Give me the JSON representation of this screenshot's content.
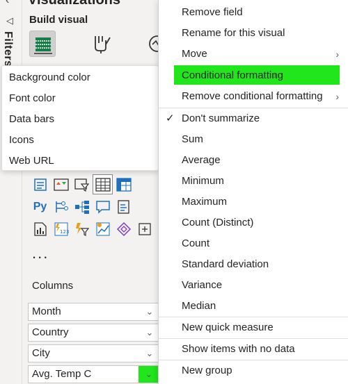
{
  "filters": {
    "label": "Filters"
  },
  "viz": {
    "header": "Visualizations",
    "build_visual": "Build visual",
    "columns_label": "Columns",
    "more": "...",
    "fields": [
      {
        "label": "Month"
      },
      {
        "label": "Country"
      },
      {
        "label": "City"
      },
      {
        "label": "Avg. Temp C"
      }
    ]
  },
  "submenu": {
    "items": [
      "Background color",
      "Font color",
      "Data bars",
      "Icons",
      "Web URL"
    ]
  },
  "menu": {
    "items": {
      "remove_field": "Remove field",
      "rename": "Rename for this visual",
      "move": "Move",
      "conditional_formatting": "Conditional formatting",
      "remove_conditional": "Remove conditional formatting",
      "dont_summarize": "Don't summarize",
      "sum": "Sum",
      "average": "Average",
      "minimum": "Minimum",
      "maximum": "Maximum",
      "count_distinct": "Count (Distinct)",
      "count": "Count",
      "stddev": "Standard deviation",
      "variance": "Variance",
      "median": "Median",
      "new_quick_measure": "New quick measure",
      "show_items_no_data": "Show items with no data",
      "new_group": "New group"
    }
  },
  "colors": {
    "highlight": "#21e61b",
    "accent_blue": "#1f6fbf"
  }
}
